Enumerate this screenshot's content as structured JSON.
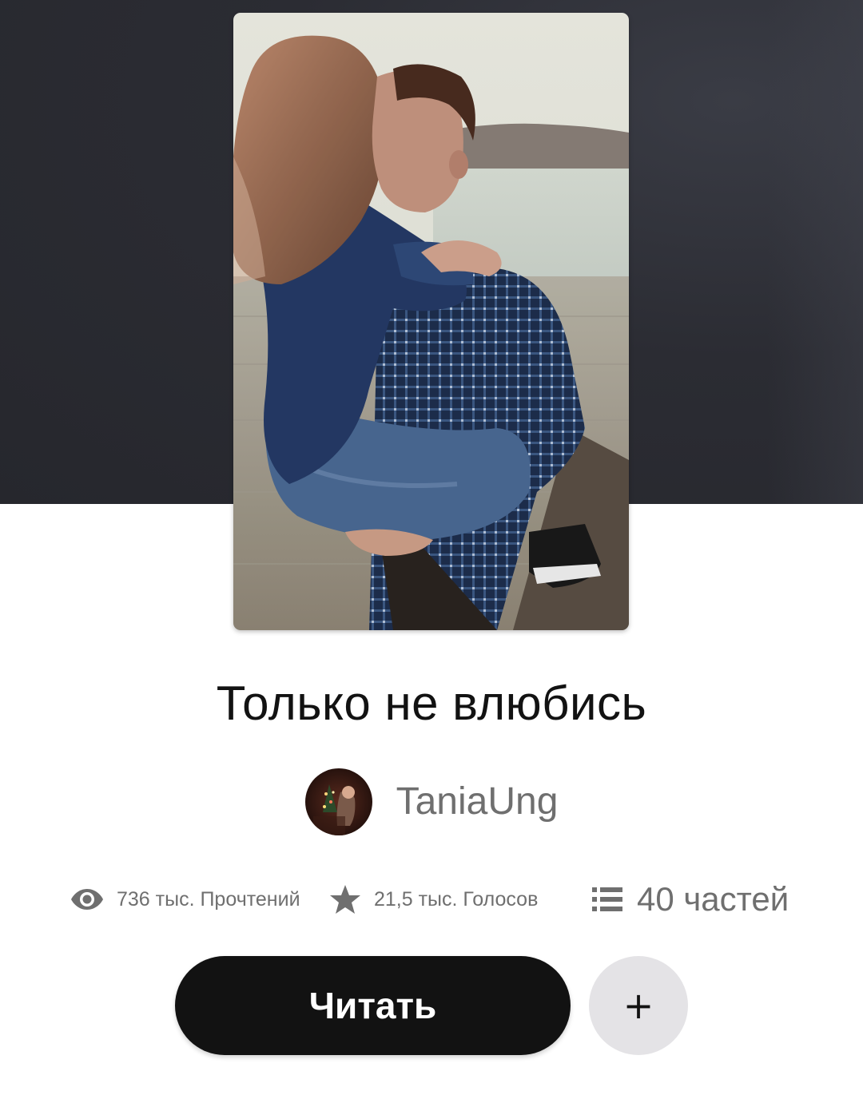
{
  "story": {
    "title": "Только не влюбись",
    "cover_image": "cover-photo",
    "author": {
      "name": "TaniaUng",
      "avatar": "author-avatar"
    }
  },
  "stats": {
    "reads": "736 тыс. Прочтений",
    "votes": "21,5 тыс. Голосов",
    "parts": "40 частей"
  },
  "actions": {
    "read_label": "Читать",
    "add_label": "+"
  },
  "icons": {
    "reads": "eye-icon",
    "votes": "star-icon",
    "parts": "list-icon"
  },
  "colors": {
    "header_background": "#2b2c33",
    "primary_button": "#121212",
    "primary_button_text": "#ffffff",
    "secondary_button": "#e4e3e6",
    "muted_text": "#6f6f6f"
  }
}
